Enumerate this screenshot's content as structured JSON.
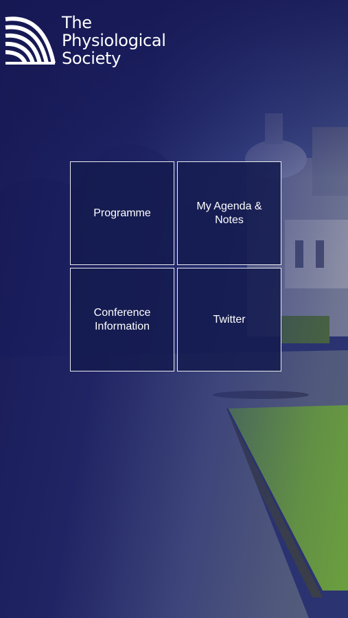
{
  "brand": {
    "logo_icon": "stripes-logo-icon",
    "name_lines": [
      "The",
      "Physiological",
      "Society"
    ]
  },
  "menu": {
    "tiles": [
      {
        "label": "Programme"
      },
      {
        "label": "My Agenda &\nNotes"
      },
      {
        "label": "Conference\nInformation"
      },
      {
        "label": "Twitter"
      }
    ]
  },
  "colors": {
    "overlay": "#1c1f5e",
    "tile_background": "#141b4e",
    "tile_border": "#ffffff",
    "text": "#ffffff"
  }
}
